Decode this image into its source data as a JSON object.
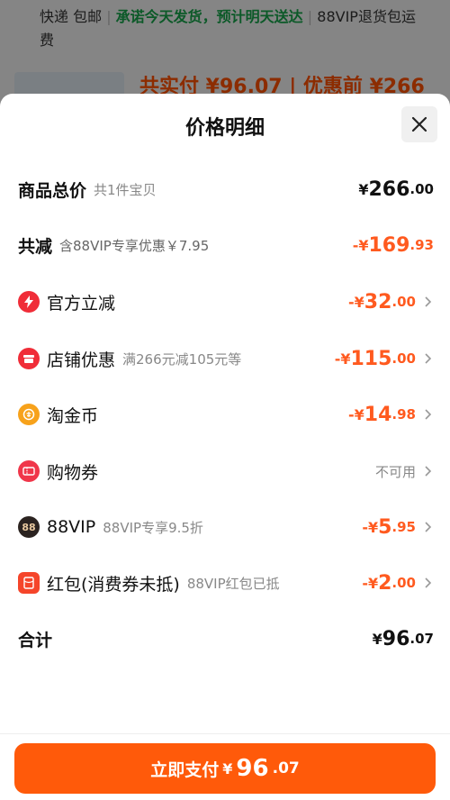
{
  "background": {
    "shipping": {
      "method": "快递 包邮",
      "promise": "承诺今天发货，预计明天送达",
      "vip": "88VIP退货包运费"
    },
    "total_peek": "共实付 ¥96.07  |  优惠前 ¥266"
  },
  "sheet": {
    "title": "价格明细",
    "rows": {
      "goods_total": {
        "label": "商品总价",
        "sub": "共1件宝贝",
        "yen": "¥",
        "main": "266",
        "dec": ".00"
      },
      "total_reduce": {
        "label": "共减",
        "sub": "含88VIP专享优惠￥7.95",
        "yen": "-¥",
        "main": "169",
        "dec": ".93"
      },
      "official": {
        "label": "官方立减",
        "yen": "-¥",
        "main": "32",
        "dec": ".00"
      },
      "store": {
        "label": "店铺优惠",
        "sub": "满266元减105元等",
        "yen": "-¥",
        "main": "115",
        "dec": ".00"
      },
      "coins": {
        "label": "淘金币",
        "yen": "-¥",
        "main": "14",
        "dec": ".98"
      },
      "coupon": {
        "label": "购物券",
        "status": "不可用"
      },
      "vip": {
        "label": "88VIP",
        "sub": "88VIP专享9.5折",
        "yen": "-¥",
        "main": "5",
        "dec": ".95",
        "badge": "88"
      },
      "redpacket": {
        "label": "红包(消费券未抵)",
        "sub": "88VIP红包已抵",
        "yen": "-¥",
        "main": "2",
        "dec": ".00"
      },
      "sum": {
        "label": "合计",
        "yen": "¥",
        "main": "96",
        "dec": ".07"
      }
    }
  },
  "pay_button": {
    "label": "立即支付",
    "yen": "¥",
    "main": "96",
    "dec": ".07"
  },
  "colors": {
    "accent": "#ff5a0a",
    "discount": "#ff5a1f",
    "official_icon": "#f02d38",
    "store_icon": "#f02d38",
    "coin_icon": "#f7a21b",
    "coupon_icon": "#f0364a",
    "vip_icon": "#2b2320",
    "redpacket_icon": "#f5452a"
  },
  "icons": {
    "close": "close-icon",
    "official": "lightning-icon",
    "store": "shop-icon",
    "coins": "coin-icon",
    "coupon": "ticket-icon",
    "vip": "vip-badge-icon",
    "redpacket": "red-packet-icon",
    "chevron": "chevron-right-icon"
  }
}
